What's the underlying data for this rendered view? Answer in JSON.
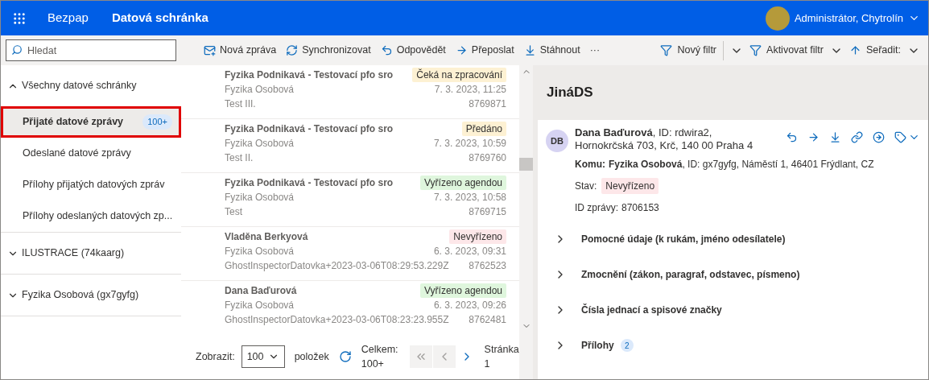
{
  "header": {
    "app_name": "Bezpap",
    "section_title": "Datová schránka",
    "user_name": "Administrátor, Chytrolín"
  },
  "search": {
    "placeholder": "Hledat"
  },
  "toolbar": {
    "actions": [
      "Nová zpráva",
      "Synchronizovat",
      "Odpovědět",
      "Přeposlat",
      "Stáhnout",
      "···"
    ],
    "filters": [
      "Nový filtr",
      "Aktivovat filtr",
      "Seřadit:"
    ]
  },
  "sidebar": {
    "groups": [
      {
        "label": "Všechny datové schránky",
        "expanded": true,
        "children": [
          {
            "label": "Přijaté datové zprávy",
            "badge": "100+",
            "selected": true
          },
          {
            "label": "Odeslané datové zprávy",
            "selected": false
          },
          {
            "label": "Přílohy přijatých datových zpráv",
            "selected": false
          },
          {
            "label": "Přílohy odeslaných datových zp...",
            "selected": false
          }
        ]
      },
      {
        "label": "ILUSTRACE (74kaarg)",
        "expanded": false
      },
      {
        "label": "Fyzika Osobová (gx7gyfg)",
        "expanded": false
      }
    ]
  },
  "messages": [
    {
      "sender": "Fyzika Podnikavá - Testovací pfo sro",
      "status": "Čeká na zpracování",
      "color": "#fdf1d3",
      "recipient": "Fyzika Osobová",
      "date": "7. 3. 2023, 11:25",
      "subject": "Test III.",
      "id": "8769871"
    },
    {
      "sender": "Fyzika Podnikavá - Testovací pfo sro",
      "status": "Předáno",
      "color": "#fdf1d3",
      "recipient": "Fyzika Osobová",
      "date": "7. 3. 2023, 10:59",
      "subject": "Test II.",
      "id": "8769760"
    },
    {
      "sender": "Fyzika Podnikavá - Testovací pfo sro",
      "status": "Vyřízeno agendou",
      "color": "#dff6dd",
      "recipient": "Fyzika Osobová",
      "date": "7. 3. 2023, 10:58",
      "subject": "Test",
      "id": "8769715"
    },
    {
      "sender": "Vladěna Berkyová",
      "status": "Nevyřízeno",
      "color": "#fde7e9",
      "recipient": "Fyzika Osobová",
      "date": "6. 3. 2023, 09:31",
      "subject": "GhostInspectorDatovka+2023-03-06T08:29:53.229Z",
      "id": "8762523"
    },
    {
      "sender": "Dana Baďurová",
      "status": "Vyřízeno agendou",
      "color": "#dff6dd",
      "recipient": "Fyzika Osobová",
      "date": "6. 3. 2023, 09:26",
      "subject": "GhostInspectorDatovka+2023-03-06T08:23:23.955Z",
      "id": "8762481"
    }
  ],
  "pagination": {
    "show_label": "Zobrazit:",
    "page_size": "100",
    "items_label": "položek",
    "total_label": "Celkem:",
    "total": "100+",
    "page_label": "Stránka",
    "page": "1"
  },
  "detail": {
    "title": "JináDS",
    "avatar_initials": "DB",
    "sender": "**Dana Baďurová**, ID: rdwira2, Hornokrčská 703, Krč, 140 00 Praha 4",
    "to_label": "Komu:",
    "to": "**Fyzika Osobová**, ID: gx7gyfg, Náměstí 1, 46401 Frýdlant, CZ",
    "state_label": "Stav:",
    "state": "Nevyřízeno",
    "id_label": "ID zprávy:",
    "id": "8706153",
    "sections": [
      {
        "label": "Pomocné údaje (k rukám, jméno odesílatele)",
        "expanded": false
      },
      {
        "label": "Zmocnění (zákon, paragraf, odstavec, písmeno)",
        "expanded": false
      },
      {
        "label": "Čísla jednací a spisové značky",
        "expanded": false
      },
      {
        "label": "Přílohy",
        "count": "2",
        "expanded": false
      }
    ]
  }
}
